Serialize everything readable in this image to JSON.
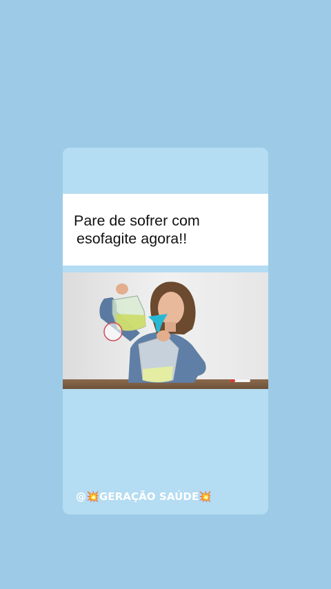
{
  "post": {
    "headline_line1": "Pare de sofrer com",
    "headline_line2": "esofagite agora!!",
    "watermark": "@💥GERAÇÃO SAÚDE💥"
  },
  "colors": {
    "page_background": "#9dcbe7",
    "card_background": "#b4dcf2",
    "headline_background": "#ffffff"
  },
  "icons": {
    "video_frame": "woman-pouring-liquid-funnel-bag"
  }
}
